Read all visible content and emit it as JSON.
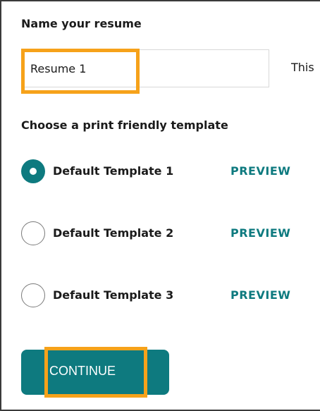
{
  "name_section": {
    "title": "Name your resume",
    "input_value": "Resume 1",
    "helper_text": "This"
  },
  "template_section": {
    "title": "Choose a print friendly template",
    "selected_index": 0,
    "options": [
      {
        "label": "Default Template 1",
        "preview_label": "PREVIEW",
        "checked": true
      },
      {
        "label": "Default Template 2",
        "preview_label": "PREVIEW",
        "checked": false
      },
      {
        "label": "Default Template 3",
        "preview_label": "PREVIEW",
        "checked": false
      }
    ]
  },
  "actions": {
    "continue_label": "CONTINUE"
  },
  "colors": {
    "accent": "#0e7a7f",
    "highlight": "#f6a21a"
  }
}
